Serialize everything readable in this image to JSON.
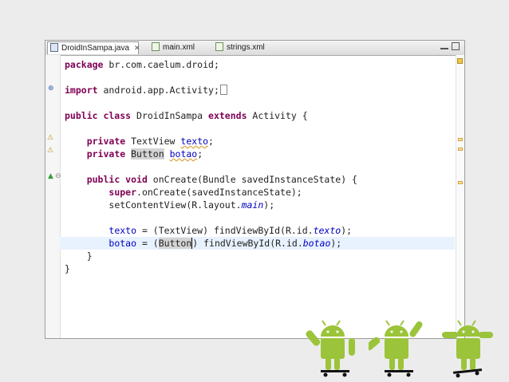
{
  "tabs": [
    {
      "label": "DroidInSampa.java",
      "close": "✕",
      "icon": "java-file-icon",
      "active": true
    },
    {
      "label": "main.xml",
      "icon": "xml-file-icon",
      "active": false
    },
    {
      "label": "strings.xml",
      "icon": "xml-file-icon",
      "active": false
    }
  ],
  "colors": {
    "keyword": "#7f0055",
    "field": "#0000c0",
    "current_line": "#e8f2fe",
    "android_green": "#9bc43a"
  },
  "code": {
    "l1": {
      "kw": "package",
      "rest": " br.com.caelum.droid;"
    },
    "l2": {
      "kw": "import",
      "rest": " android.app.Activity;"
    },
    "l3": {
      "kw1": "public class",
      "name": " DroidInSampa ",
      "kw2": "extends",
      "rest": " Activity {"
    },
    "l4": {
      "kw": "private",
      "type": " TextView ",
      "field": "texto",
      "end": ";"
    },
    "l5": {
      "kw": "private",
      "sp": " ",
      "type": "Button",
      "sp2": " ",
      "field": "botao",
      "end": ";"
    },
    "l6": {
      "kw1": "public void",
      "rest": " onCreate(Bundle savedInstanceState) {"
    },
    "l7": {
      "kw": "super",
      "rest": ".onCreate(savedInstanceState);"
    },
    "l8": {
      "pre": "setContentView(R.layout.",
      "ital": "main",
      "end": ");"
    },
    "l9": {
      "field": "texto",
      "mid": " = (TextView) findViewById(R.id.",
      "sfield": "texto",
      "end": ");"
    },
    "l10": {
      "field": "botao",
      "mid1": " = (",
      "hl": "Button",
      "mid2": ") findViewById(R.id.",
      "sfield": "botao",
      "end": ");"
    },
    "l11": "}",
    "l12": "}"
  }
}
